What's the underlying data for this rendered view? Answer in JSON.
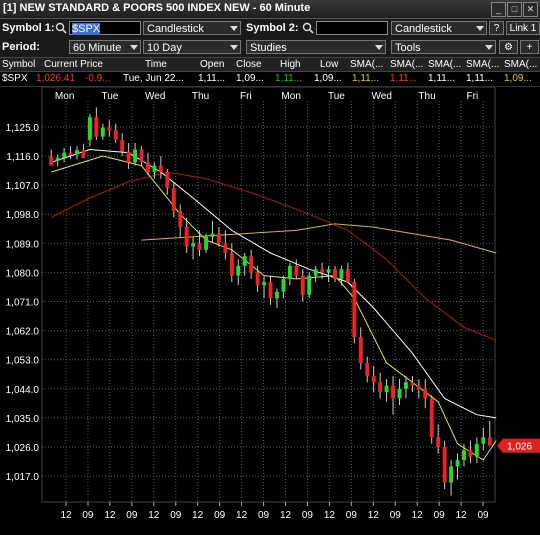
{
  "window": {
    "title": "[1] NEW STANDARD & POORS 500 INDEX NEW - 60 Minute"
  },
  "toolbar": {
    "symbol1_label": "Symbol 1:",
    "symbol1_value": "$SPX",
    "chart_type1": "Candlestick",
    "symbol2_label": "Symbol 2:",
    "symbol2_value": "",
    "chart_type2": "Candlestick",
    "help_label": "?",
    "link_label": "Link 1",
    "period_label": "Period:",
    "period_value": "60 Minute",
    "range_value": "10 Day",
    "studies_label": "Studies",
    "tools_label": "Tools"
  },
  "quote": {
    "headers": [
      "Symbol",
      "Current Price",
      "Time",
      "Open",
      "Close",
      "High",
      "Low",
      "SMA(...",
      "SMA(...",
      "SMA(...",
      "SMA(...",
      "SMA(..."
    ],
    "values": [
      "$SPX",
      "1,026.41",
      "-0.9...",
      "Tue, Jun 22...",
      "1,11...",
      "1,09...",
      "1,11...",
      "1,09...",
      "1,11...",
      "1,11...",
      "1,11...",
      "1,11...",
      "1,09..."
    ],
    "colors": {
      "up": "#00d000",
      "down": "#ff3030",
      "neutral": "#ffffff",
      "yellow": "#e0d000"
    }
  },
  "chart_data": {
    "type": "candlestick",
    "title": "",
    "day_labels": [
      "Mon",
      "Tue",
      "Wed",
      "Thu",
      "Fri",
      "Mon",
      "Tue",
      "Wed",
      "Thu",
      "Fri"
    ],
    "time_labels": [
      "12",
      "09",
      "12",
      "09",
      "12",
      "09",
      "12",
      "09",
      "12",
      "09",
      "12",
      "09",
      "12",
      "09",
      "12",
      "09",
      "12",
      "09",
      "12",
      "09"
    ],
    "y_ticks": [
      "1,125.0",
      "1,116.0",
      "1,107.0",
      "1,098.0",
      "1,089.0",
      "1,080.0",
      "1,071.0",
      "1,062.0",
      "1,053.0",
      "1,044.0",
      "1,035.0",
      "1,026.0",
      "1,017.0"
    ],
    "y_tick_values": [
      1125,
      1116,
      1107,
      1098,
      1089,
      1080,
      1071,
      1062,
      1053,
      1044,
      1035,
      1026,
      1017
    ],
    "ylim": [
      1009,
      1133
    ],
    "current_price_label": "1,026",
    "current_price": 1026.4,
    "candles": [
      [
        1116.0,
        1118.0,
        1114.0,
        1113.0
      ],
      [
        1114.5,
        1116.5,
        1112.8,
        1115.5
      ],
      [
        1115.5,
        1118.5,
        1114.0,
        1117.0
      ],
      [
        1117.0,
        1119.0,
        1115.0,
        1116.2
      ],
      [
        1116.5,
        1119.0,
        1115.0,
        1117.8
      ],
      [
        1117.8,
        1119.8,
        1115.8,
        1115.4
      ],
      [
        1121.0,
        1129.0,
        1119.0,
        1128.0
      ],
      [
        1128.0,
        1131.0,
        1121.0,
        1122.0
      ],
      [
        1122.0,
        1126.0,
        1121.0,
        1124.8
      ],
      [
        1124.8,
        1127.0,
        1122.0,
        1123.8
      ],
      [
        1124.0,
        1126.0,
        1120.0,
        1121.0
      ],
      [
        1121.0,
        1123.0,
        1116.0,
        1117.4
      ],
      [
        1117.4,
        1120.0,
        1112.0,
        1114.0
      ],
      [
        1114.0,
        1120.0,
        1113.0,
        1118.0
      ],
      [
        1118.0,
        1119.0,
        1113.0,
        1114.0
      ],
      [
        1114.0,
        1117.0,
        1110.0,
        1111.0
      ],
      [
        1111.0,
        1114.0,
        1109.0,
        1113.0
      ],
      [
        1113.0,
        1116.0,
        1109.0,
        1111.0
      ],
      [
        1111.0,
        1112.0,
        1104.0,
        1106.0
      ],
      [
        1106.0,
        1108.0,
        1097.0,
        1099.0
      ],
      [
        1099.0,
        1101.0,
        1091.0,
        1094.0
      ],
      [
        1094.0,
        1097.0,
        1086.0,
        1088.0
      ],
      [
        1088.0,
        1091.0,
        1084.0,
        1089.0
      ],
      [
        1089.0,
        1093.0,
        1085.0,
        1087.0
      ],
      [
        1087.0,
        1092.0,
        1086.0,
        1091.0
      ],
      [
        1091.0,
        1096.0,
        1089.0,
        1092.0
      ],
      [
        1092.0,
        1094.0,
        1088.0,
        1089.0
      ],
      [
        1089.0,
        1093.0,
        1084.0,
        1086.0
      ],
      [
        1086.0,
        1089.0,
        1077.0,
        1079.0
      ],
      [
        1079.0,
        1084.0,
        1076.0,
        1082.0
      ],
      [
        1082.0,
        1086.0,
        1079.0,
        1085.0
      ],
      [
        1085.0,
        1087.0,
        1078.0,
        1080.0
      ],
      [
        1080.0,
        1082.0,
        1074.0,
        1076.0
      ],
      [
        1076.0,
        1079.0,
        1072.0,
        1077.0
      ],
      [
        1077.0,
        1079.0,
        1070.0,
        1072.0
      ],
      [
        1072.0,
        1075.0,
        1069.0,
        1074.0
      ],
      [
        1074.0,
        1079.0,
        1072.0,
        1078.0
      ],
      [
        1078.0,
        1083.0,
        1076.0,
        1082.0
      ],
      [
        1082.0,
        1084.0,
        1078.0,
        1079.0
      ],
      [
        1079.0,
        1081.0,
        1071.0,
        1073.0
      ],
      [
        1073.0,
        1080.0,
        1072.0,
        1079.0
      ],
      [
        1079.0,
        1082.0,
        1077.0,
        1081.0
      ],
      [
        1081.0,
        1083.0,
        1078.0,
        1080.0
      ],
      [
        1080.0,
        1082.0,
        1077.0,
        1081.0
      ],
      [
        1081.0,
        1082.0,
        1077.0,
        1078.0
      ],
      [
        1078.0,
        1082.0,
        1076.0,
        1081.0
      ],
      [
        1081.0,
        1083.0,
        1078.0,
        1077.0
      ],
      [
        1077.0,
        1078.0,
        1058.0,
        1060.0
      ],
      [
        1060.0,
        1063.0,
        1050.0,
        1052.0
      ],
      [
        1052.0,
        1054.0,
        1046.0,
        1048.0
      ],
      [
        1048.0,
        1051.0,
        1043.0,
        1046.0
      ],
      [
        1046.0,
        1049.0,
        1041.0,
        1043.0
      ],
      [
        1043.0,
        1047.0,
        1040.0,
        1045.0
      ],
      [
        1045.0,
        1048.0,
        1036.0,
        1041.0
      ],
      [
        1041.0,
        1047.0,
        1039.0,
        1044.0
      ],
      [
        1044.0,
        1048.0,
        1041.0,
        1046.0
      ],
      [
        1046.0,
        1048.0,
        1043.0,
        1045.0
      ],
      [
        1045.0,
        1047.0,
        1041.0,
        1044.0
      ],
      [
        1044.0,
        1047.0,
        1038.0,
        1041.0
      ],
      [
        1041.0,
        1042.0,
        1027.0,
        1029.0
      ],
      [
        1029.0,
        1033.0,
        1024.0,
        1026.0
      ],
      [
        1026.0,
        1028.0,
        1013.0,
        1015.0
      ],
      [
        1015.0,
        1022.0,
        1011.0,
        1020.0
      ],
      [
        1020.0,
        1024.0,
        1016.0,
        1022.0
      ],
      [
        1022.0,
        1027.0,
        1020.0,
        1025.0
      ],
      [
        1025.0,
        1028.0,
        1021.0,
        1023.0
      ],
      [
        1023.0,
        1029.0,
        1021.0,
        1027.0
      ],
      [
        1027.0,
        1032.0,
        1025.0,
        1029.0
      ],
      [
        1029.0,
        1034.0,
        1027.0,
        1026.4
      ]
    ],
    "sma_fast": [
      [
        0,
        1111
      ],
      [
        8,
        1116
      ],
      [
        14,
        1113
      ],
      [
        20,
        1098
      ],
      [
        24,
        1090
      ],
      [
        28,
        1087
      ],
      [
        33,
        1079
      ],
      [
        38,
        1078
      ],
      [
        44,
        1079
      ],
      [
        47,
        1072
      ],
      [
        52,
        1052
      ],
      [
        56,
        1046
      ],
      [
        60,
        1040
      ],
      [
        63,
        1027
      ],
      [
        67,
        1022
      ],
      [
        69,
        1028
      ]
    ],
    "sma_mid": [
      [
        0,
        1114
      ],
      [
        6,
        1118
      ],
      [
        12,
        1117
      ],
      [
        17,
        1111
      ],
      [
        22,
        1103
      ],
      [
        28,
        1093
      ],
      [
        34,
        1086
      ],
      [
        40,
        1081
      ],
      [
        46,
        1077
      ],
      [
        50,
        1069
      ],
      [
        56,
        1055
      ],
      [
        61,
        1041
      ],
      [
        66,
        1036
      ],
      [
        69,
        1035
      ]
    ],
    "sma_slow": [
      [
        0,
        1097
      ],
      [
        6,
        1103
      ],
      [
        12,
        1108
      ],
      [
        18,
        1111
      ],
      [
        24,
        1109
      ],
      [
        32,
        1104
      ],
      [
        40,
        1098
      ],
      [
        46,
        1093
      ],
      [
        52,
        1084
      ],
      [
        58,
        1072
      ],
      [
        64,
        1063
      ],
      [
        69,
        1059
      ]
    ],
    "sma_long": [
      [
        14,
        1090
      ],
      [
        22,
        1091
      ],
      [
        30,
        1092
      ],
      [
        38,
        1093
      ],
      [
        44,
        1095
      ],
      [
        50,
        1094
      ],
      [
        56,
        1092
      ],
      [
        62,
        1090
      ],
      [
        69,
        1086
      ]
    ],
    "colors": {
      "up": "#22dd22",
      "down": "#ee2222",
      "sma_fast": "#e8e830",
      "sma_mid": "#ffffff",
      "sma_slow": "#b01818",
      "sma_long": "#c8c030",
      "grid": "#5a5a5a",
      "price_tag": "#e02020"
    }
  }
}
